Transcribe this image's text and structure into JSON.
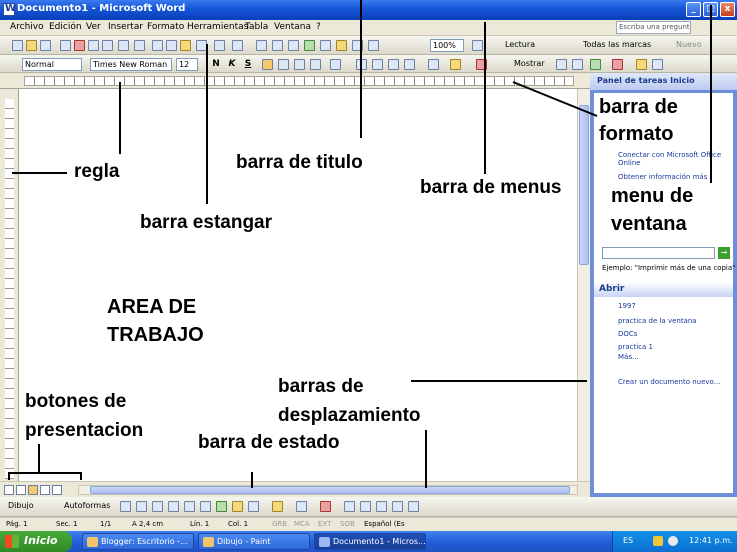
{
  "window": {
    "title": "Documento1 - Microsoft Word",
    "min": "_",
    "max": "□",
    "close": "x"
  },
  "menu": {
    "items": [
      "Archivo",
      "Edición",
      "Ver",
      "Insertar",
      "Formato",
      "Herramientas",
      "Tabla",
      "Ventana",
      "?"
    ],
    "help_placeholder": "Escriba una pregunta"
  },
  "toolbar_standard": {
    "zoom": "100%",
    "read_label": "Lectura",
    "markup_label": "Todas las marcas",
    "new_label": "Nuevo"
  },
  "toolbar_format": {
    "style": "Normal",
    "font": "Times New Roman",
    "size": "12",
    "bold": "N",
    "italic": "K",
    "underline": "S",
    "mostrar": "Mostrar"
  },
  "taskpane": {
    "title": "Panel de tareas Inicio",
    "links": [
      "Conectar con Microsoft Office Online",
      "Obtener información más"
    ],
    "search_example": "Ejemplo: \"Imprimir más de una copia\"",
    "open_header": "Abrir",
    "files": [
      "1997",
      "practica de la ventana",
      "DOCs",
      "practica 1",
      "Más..."
    ],
    "new_doc": "Crear un documento nuevo..."
  },
  "drawing": {
    "dibujo": "Dibujo",
    "autoformas": "Autoformas"
  },
  "status": {
    "pag": "Pág. 1",
    "sec": "Sec. 1",
    "pages": "1/1",
    "pos": "A 2,4 cm",
    "lin": "Lín. 1",
    "col": "Col. 1",
    "grb": "GRB",
    "mca": "MCA",
    "ext": "EXT",
    "sob": "SOB",
    "lang": "Español (Es"
  },
  "taskbar": {
    "start": "Inicio",
    "tasks": [
      "Blogger: Escritorio -...",
      "Dibujo - Paint",
      "Documento1 - Micros..."
    ],
    "lang": "ES",
    "clock": "12:41 p.m."
  },
  "annotations": {
    "regla": "regla",
    "barra_titulo": "barra de titulo",
    "barra_estandar": "barra estangar",
    "barra_formato_1": "barra de",
    "barra_formato_2": "formato",
    "barra_menus": "barra de menus",
    "menu_ventana_1": "menu de",
    "menu_ventana_2": "ventana",
    "area_1": "AREA DE",
    "area_2": "TRABAJO",
    "botones_1": "botones de",
    "botones_2": "presentacion",
    "barras_desp_1": "barras de",
    "barras_desp_2": "desplazamiento",
    "barra_estado": "barra de estado"
  }
}
